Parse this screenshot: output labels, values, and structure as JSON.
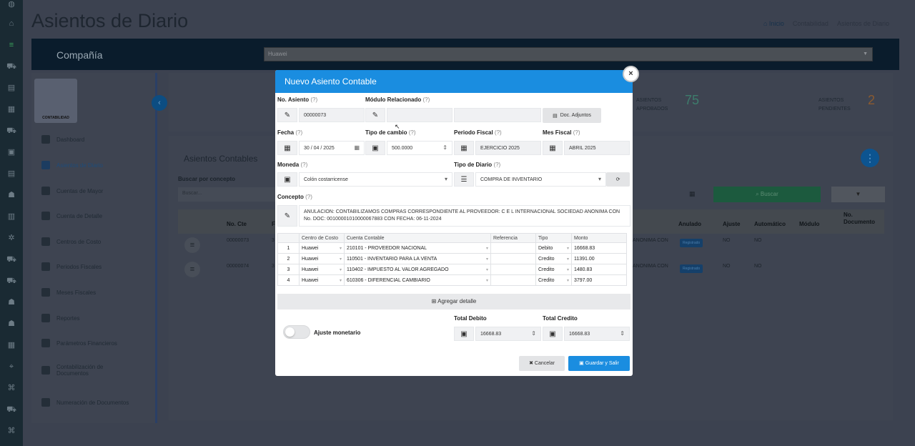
{
  "page": {
    "title": "Asientos de Diario"
  },
  "breadcrumb": {
    "home": "Inicio",
    "level1": "Contabilidad",
    "level2": "Asientos de Diario"
  },
  "company": {
    "label": "Compañía",
    "selected": "Huawei"
  },
  "sidebar": {
    "logo_text": "CONTABILIDAD",
    "items": [
      {
        "label": "Dashboard",
        "icon": "pie-chart-icon"
      },
      {
        "label": "Asientos de Diario",
        "icon": "file-icon"
      },
      {
        "label": "Cuentas de Mayor",
        "icon": "list-icon"
      },
      {
        "label": "Cuenta de Detalle",
        "icon": "list-icon"
      },
      {
        "label": "Centros de Costo",
        "icon": "building-icon"
      },
      {
        "label": "Periodos Fiscales",
        "icon": "calendar-icon"
      },
      {
        "label": "Meses Fiscales",
        "icon": "calendar-icon"
      },
      {
        "label": "Reportes",
        "icon": "file-icon"
      },
      {
        "label": "Parámetros Financieros",
        "icon": "gear-icon"
      },
      {
        "label": "Contabilización de Documentos",
        "icon": "file-icon"
      },
      {
        "label": "Numeración de Documentos",
        "icon": "file-icon"
      }
    ]
  },
  "stats": {
    "aprobados_label": "ASIENTOS APROBADOS",
    "aprobados_value": "75",
    "pendientes_label": "ASIENTOS PENDIENTES",
    "pendientes_value": "2"
  },
  "list": {
    "title": "Asientos Contables",
    "search_label": "Buscar por concepto",
    "search_placeholder": "Buscar...",
    "search_button": "Buscar",
    "headers": [
      "No. Cte",
      "F",
      "Anulado",
      "Ajuste",
      "Automático",
      "Módulo",
      "No. Documento"
    ],
    "rows": [
      {
        "no": "00000073",
        "f": "3",
        "concept": "ANONIMA CON",
        "anulado": "Registrado",
        "ajuste": "NO",
        "auto": "NO"
      },
      {
        "no": "00000074",
        "f": "3",
        "concept": "ANONIMA CON",
        "anulado": "Registrado",
        "ajuste": "NO",
        "auto": "NO"
      }
    ]
  },
  "modal": {
    "title": "Nuevo Asiento Contable",
    "no_asiento_label": "No. Asiento",
    "no_asiento_value": "00000073",
    "modulo_label": "Módulo Relacionado",
    "doc_adjuntos": "Doc. Adjuntos",
    "fecha_label": "Fecha",
    "fecha_value": "30 / 04 / 2025",
    "tipo_cambio_label": "Tipo de cambio",
    "tipo_cambio_value": "500.0000",
    "periodo_label": "Periodo Fiscal",
    "periodo_value": "EJERCICIO 2025",
    "mes_label": "Mes Fiscal",
    "mes_value": "ABRIL 2025",
    "moneda_label": "Moneda",
    "moneda_value": "Colón costarricense",
    "tipo_diario_label": "Tipo de Diario",
    "tipo_diario_value": "COMPRA DE INVENTARIO",
    "concepto_label": "Concepto",
    "concepto_value": "ANULACION: CONTABILIZAMOS COMPRAS CORRESPONDIENTE AL PROVEEDOR: C E L INTERNACIONAL SOCIEDAD ANONIMA CON No. DOC: 00100001010000067883 CON FECHA: 06-11-2024",
    "help_mark": "(?)",
    "detail_headers": [
      "Centro de Costo",
      "Cuenta Contable",
      "Referencia",
      "Tipo",
      "Monto"
    ],
    "details": [
      {
        "n": "1",
        "centro": "Huawei",
        "cuenta": "210101 - PROVEEDOR NACIONAL",
        "ref": "",
        "tipo": "Debito",
        "monto": "16668.83"
      },
      {
        "n": "2",
        "centro": "Huawei",
        "cuenta": "110501 - INVENTARIO PARA LA VENTA",
        "ref": "",
        "tipo": "Credito",
        "monto": "11391.00"
      },
      {
        "n": "3",
        "centro": "Huawei",
        "cuenta": "110402 - IMPUESTO AL VALOR AGREGADO",
        "ref": "",
        "tipo": "Credito",
        "monto": "1480.83"
      },
      {
        "n": "4",
        "centro": "Huawei",
        "cuenta": "610306 - DIFERENCIAL CAMBIARIO",
        "ref": "",
        "tipo": "Credito",
        "monto": "3797.00"
      }
    ],
    "agregar_detalle": "Agregar detalle",
    "ajuste_label": "Ajuste monetario",
    "total_debito_label": "Total Debito",
    "total_debito_value": "16668.83",
    "total_credito_label": "Total Credito",
    "total_credito_value": "16668.83",
    "cancel": "Cancelar",
    "save": "Guardar y Salir"
  }
}
